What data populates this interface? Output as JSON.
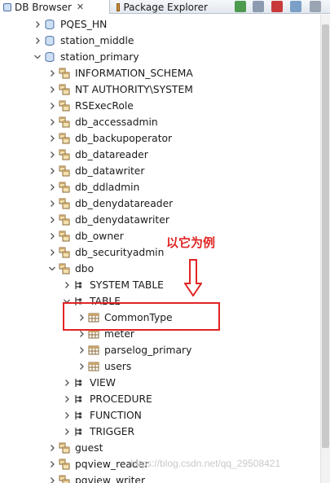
{
  "tabs": [
    {
      "label": "DB Browser",
      "close": "✕",
      "active": true
    },
    {
      "label": "Package Explorer",
      "active": false
    }
  ],
  "tree": [
    {
      "label": "PQES_HN",
      "level": 0,
      "expanded": false,
      "icon": "database-icon"
    },
    {
      "label": "station_middle",
      "level": 0,
      "expanded": false,
      "icon": "database-icon"
    },
    {
      "label": "station_primary",
      "level": 0,
      "expanded": true,
      "icon": "database-icon"
    },
    {
      "label": "INFORMATION_SCHEMA",
      "level": 1,
      "expanded": false,
      "icon": "schema-icon"
    },
    {
      "label": "NT AUTHORITY\\SYSTEM",
      "level": 1,
      "expanded": false,
      "icon": "schema-icon"
    },
    {
      "label": "RSExecRole",
      "level": 1,
      "expanded": false,
      "icon": "schema-icon"
    },
    {
      "label": "db_accessadmin",
      "level": 1,
      "expanded": false,
      "icon": "schema-icon"
    },
    {
      "label": "db_backupoperator",
      "level": 1,
      "expanded": false,
      "icon": "schema-icon"
    },
    {
      "label": "db_datareader",
      "level": 1,
      "expanded": false,
      "icon": "schema-icon"
    },
    {
      "label": "db_datawriter",
      "level": 1,
      "expanded": false,
      "icon": "schema-icon"
    },
    {
      "label": "db_ddladmin",
      "level": 1,
      "expanded": false,
      "icon": "schema-icon"
    },
    {
      "label": "db_denydatareader",
      "level": 1,
      "expanded": false,
      "icon": "schema-icon"
    },
    {
      "label": "db_denydatawriter",
      "level": 1,
      "expanded": false,
      "icon": "schema-icon"
    },
    {
      "label": "db_owner",
      "level": 1,
      "expanded": false,
      "icon": "schema-icon"
    },
    {
      "label": "db_securityadmin",
      "level": 1,
      "expanded": false,
      "icon": "schema-icon"
    },
    {
      "label": "dbo",
      "level": 1,
      "expanded": true,
      "icon": "schema-icon"
    },
    {
      "label": "SYSTEM TABLE",
      "level": 2,
      "expanded": false,
      "icon": "folder-tree-icon"
    },
    {
      "label": "TABLE",
      "level": 2,
      "expanded": true,
      "icon": "folder-tree-icon"
    },
    {
      "label": "CommonType",
      "level": 3,
      "expanded": false,
      "icon": "table-icon"
    },
    {
      "label": "meter",
      "level": 3,
      "expanded": false,
      "icon": "table-icon"
    },
    {
      "label": "parselog_primary",
      "level": 3,
      "expanded": false,
      "icon": "table-icon"
    },
    {
      "label": "users",
      "level": 3,
      "expanded": false,
      "icon": "table-icon"
    },
    {
      "label": "VIEW",
      "level": 2,
      "expanded": false,
      "icon": "folder-tree-icon"
    },
    {
      "label": "PROCEDURE",
      "level": 2,
      "expanded": false,
      "icon": "folder-tree-icon"
    },
    {
      "label": "FUNCTION",
      "level": 2,
      "expanded": false,
      "icon": "folder-tree-icon"
    },
    {
      "label": "TRIGGER",
      "level": 2,
      "expanded": false,
      "icon": "folder-tree-icon"
    },
    {
      "label": "guest",
      "level": 1,
      "expanded": false,
      "icon": "schema-icon"
    },
    {
      "label": "pqview_reader",
      "level": 1,
      "expanded": false,
      "icon": "schema-icon"
    },
    {
      "label": "pqview_writer",
      "level": 1,
      "expanded": false,
      "icon": "schema-icon"
    }
  ],
  "annotation": {
    "label": "以它为例",
    "color": "#e02424"
  },
  "watermark": "https://blog.csdn.net/qq_29508421"
}
